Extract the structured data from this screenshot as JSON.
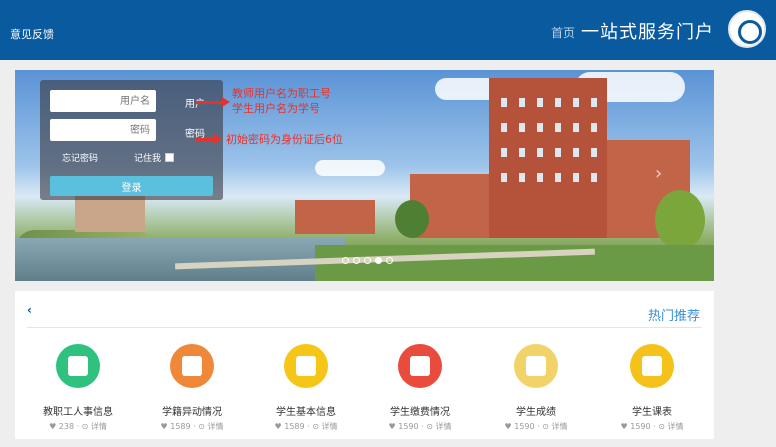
{
  "header": {
    "site_title": "一站式服务门户",
    "nav_home": "首页",
    "feedback": "意见反馈"
  },
  "login": {
    "username_placeholder": "用户名",
    "password_placeholder": "密码",
    "username_label": "用户",
    "password_label": "密码",
    "remember_label": "记住我",
    "forgot_label": "忘记密码",
    "login_button": "登录"
  },
  "annotations": {
    "user_note_line1": "教师用户名为职工号",
    "user_note_line2": "学生用户名为学号",
    "password_note": "初始密码为身份证后6位"
  },
  "recommend": {
    "title": "热门推荐",
    "services": [
      {
        "name": "学生课表",
        "meta": "♥ 1590 · ⊙ 详情",
        "color": "#f4c21a",
        "icon": "calendar-icon"
      },
      {
        "name": "学生成绩",
        "meta": "♥ 1590 · ⊙ 详情",
        "color": "#f2d36a",
        "icon": "grade-icon"
      },
      {
        "name": "学生缴费情况",
        "meta": "♥ 1590 · ⊙ 详情",
        "color": "#e94b3c",
        "icon": "payment-icon"
      },
      {
        "name": "学生基本信息",
        "meta": "♥ 1589 · ⊙ 详情",
        "color": "#f5c518",
        "icon": "user-icon"
      },
      {
        "name": "学籍异动情况",
        "meta": "♥ 1589 · ⊙ 详情",
        "color": "#f0883a",
        "icon": "status-change-icon"
      },
      {
        "name": "教职工人事信息",
        "meta": "♥ 238 · ⊙ 详情",
        "color": "#2ec27e",
        "icon": "staff-icon"
      }
    ]
  }
}
